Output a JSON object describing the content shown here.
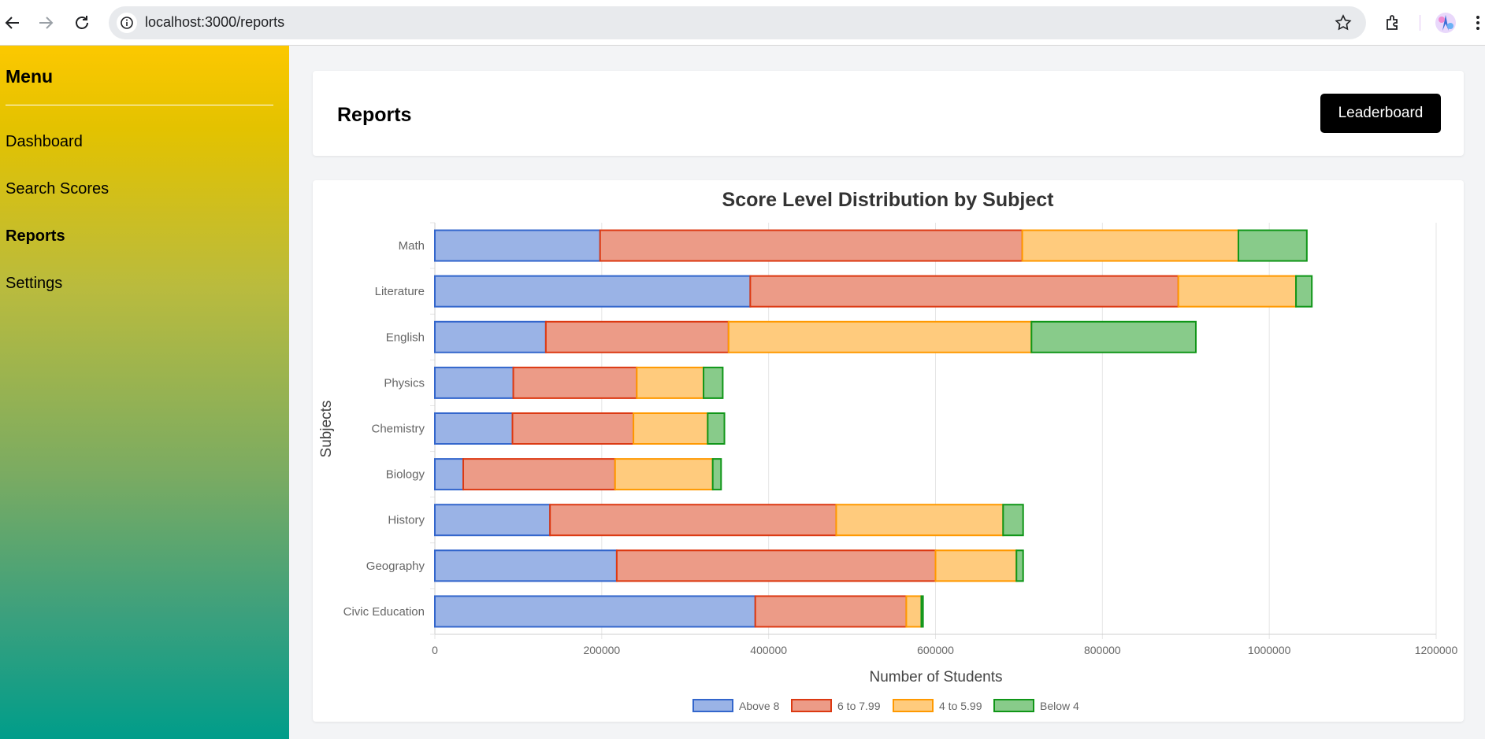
{
  "browser": {
    "url": "localhost:3000/reports",
    "icons": [
      "back-arrow-icon",
      "forward-arrow-icon",
      "reload-icon",
      "info-icon",
      "star-icon",
      "extensions-icon",
      "profile-avatar-icon",
      "more-icon"
    ]
  },
  "sidebar": {
    "title": "Menu",
    "items": [
      {
        "label": "Dashboard",
        "active": false
      },
      {
        "label": "Search Scores",
        "active": false
      },
      {
        "label": "Reports",
        "active": true
      },
      {
        "label": "Settings",
        "active": false
      }
    ]
  },
  "header": {
    "title": "Reports",
    "leaderboard_label": "Leaderboard"
  },
  "colors": {
    "above8_fill": "#9ab3e6",
    "above8_stroke": "#3366cc",
    "6to799_fill": "#ec9b87",
    "6to799_stroke": "#dc3912",
    "4to599_fill": "#ffcb7d",
    "4to599_stroke": "#ff9900",
    "below4_fill": "#88cb8a",
    "below4_stroke": "#109618",
    "sidebar_top": "#fcc800",
    "sidebar_bottom": "#009d8a"
  },
  "chart_data": {
    "type": "bar",
    "orientation": "horizontal",
    "stacked": true,
    "title": "Score Level Distribution by Subject",
    "xlabel": "Number of Students",
    "ylabel": "Subjects",
    "xlim": [
      0,
      1200000
    ],
    "xticks": [
      "0",
      "200000",
      "400000",
      "600000",
      "800000",
      "1000000",
      "1200000"
    ],
    "grid": true,
    "legend_position": "bottom",
    "categories": [
      "Math",
      "Literature",
      "English",
      "Physics",
      "Chemistry",
      "Biology",
      "History",
      "Geography",
      "Civic Education"
    ],
    "series": [
      {
        "name": "Above 8",
        "values": [
          198000,
          378000,
          133000,
          94000,
          93000,
          34000,
          138000,
          218000,
          384000
        ]
      },
      {
        "name": "6 to 7.99",
        "values": [
          506000,
          513000,
          219000,
          148000,
          145000,
          182000,
          343000,
          382000,
          181000
        ]
      },
      {
        "name": "4 to 5.99",
        "values": [
          259000,
          141000,
          363000,
          80000,
          89000,
          117000,
          200000,
          97000,
          18000
        ]
      },
      {
        "name": "Below 4",
        "values": [
          82000,
          19000,
          197000,
          23000,
          20000,
          10000,
          24000,
          8000,
          2000
        ]
      }
    ]
  }
}
